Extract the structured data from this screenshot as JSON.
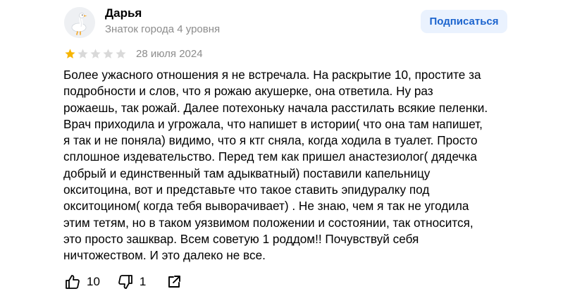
{
  "author": {
    "name": "Дарья",
    "level": "Знаток города 4 уровня",
    "avatar_icon": "goose-avatar-icon"
  },
  "subscribe": {
    "label": "Подписаться"
  },
  "review": {
    "rating": 1,
    "rating_max": 5,
    "date": "28 июля 2024",
    "text": "Более ужасного отношения я не встречала. На раскрытие 10, простите за\nподробности и слов, что я рожаю акушерке, она ответила. Ну раз\nрожаешь, так рожай. Далее потехоньку начала расстилать всякие пеленки.\nВрач приходила и угрожала, что напишет в истории( что она там напишет,\nя так и не поняла) видимо, что я ктг сняла, когда ходила в туалет. Просто\nсплошное издевательство. Перед тем как пришел анастезиолог( дядечка\nдобрый и единственный там адыкватный) поставили капельницу\nокситоцина, вот и представьте что такое ставить эпидуралку под\nокситоцином( когда тебя выворачивает) . Не знаю, чем я так не угодила\nэтим тетям, но в таком уязвимом положении и состоянии, так относится,\nэто просто зашквар. Всем советую 1 роддом!! Почувствуй себя\nничтожеством. И это далеко не все."
  },
  "actions": {
    "likes": "10",
    "dislikes": "1",
    "like_icon": "thumbs-up-icon",
    "dislike_icon": "thumbs-down-icon",
    "share_icon": "share-icon"
  },
  "colors": {
    "star_filled": "#f7b500",
    "star_empty": "#d9d9d9",
    "subscribe_bg": "#eaf2fe",
    "subscribe_text": "#1c64ce",
    "muted_text": "#8c8c8c"
  }
}
